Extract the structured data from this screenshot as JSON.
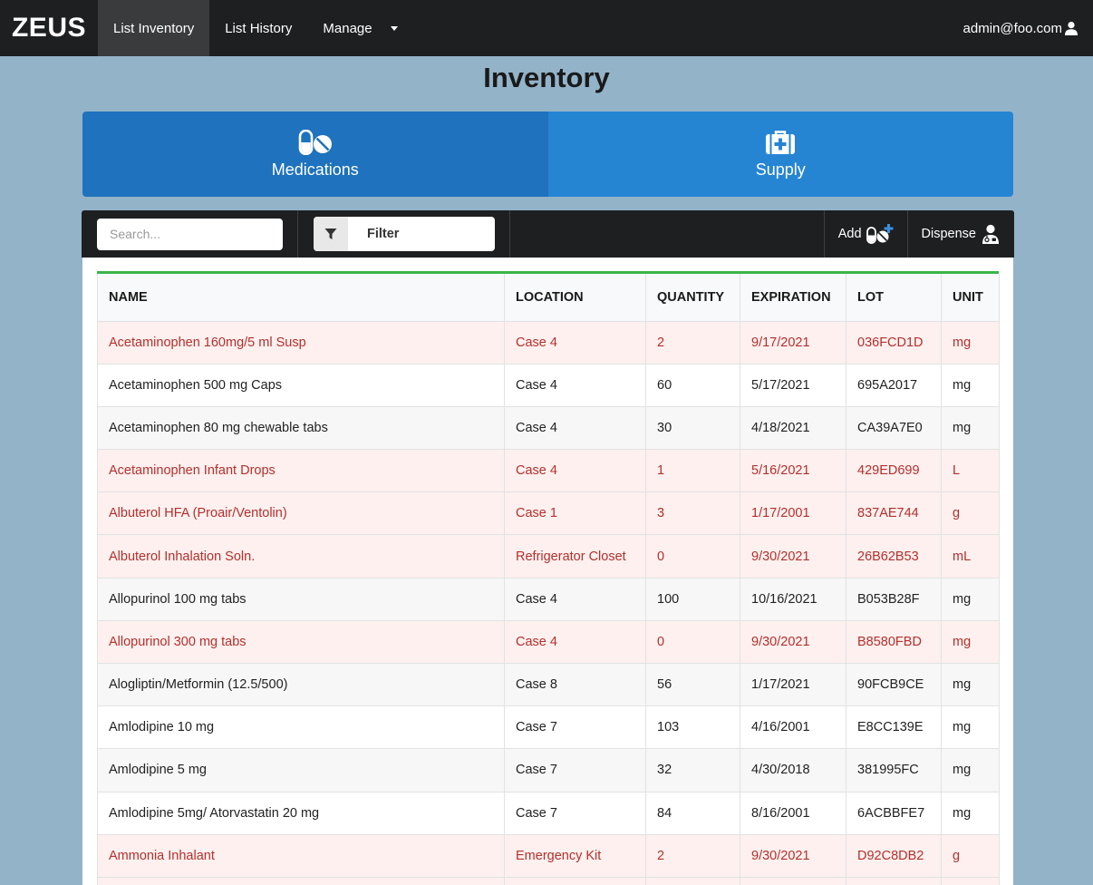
{
  "navbar": {
    "brand": "ZEUS",
    "items": [
      {
        "label": "List Inventory",
        "active": true
      },
      {
        "label": "List History",
        "active": false
      },
      {
        "label": "Manage",
        "active": false,
        "dropdown": true
      }
    ],
    "user_email": "admin@foo.com",
    "user_icon": "user-icon"
  },
  "page_title": "Inventory",
  "category_tabs": [
    {
      "label": "Medications",
      "icon": "pills-icon",
      "active": true
    },
    {
      "label": "Supply",
      "icon": "medkit-icon",
      "active": false
    }
  ],
  "toolbar": {
    "search_placeholder": "Search...",
    "search_value": "",
    "filter_label": "Filter",
    "add_label": "Add",
    "dispense_label": "Dispense"
  },
  "table": {
    "columns": [
      "NAME",
      "LOCATION",
      "QUANTITY",
      "EXPIRATION",
      "LOT",
      "UNIT"
    ],
    "rows": [
      {
        "name": "Acetaminophen 160mg/5 ml Susp",
        "location": "Case 4",
        "quantity": "2",
        "expiration": "9/17/2021",
        "lot": "036FCD1D",
        "unit": "mg",
        "alert": true
      },
      {
        "name": "Acetaminophen 500 mg Caps",
        "location": "Case 4",
        "quantity": "60",
        "expiration": "5/17/2021",
        "lot": "695A2017",
        "unit": "mg",
        "alert": false
      },
      {
        "name": "Acetaminophen 80 mg chewable tabs",
        "location": "Case 4",
        "quantity": "30",
        "expiration": "4/18/2021",
        "lot": "CA39A7E0",
        "unit": "mg",
        "alert": false
      },
      {
        "name": "Acetaminophen Infant Drops",
        "location": "Case 4",
        "quantity": "1",
        "expiration": "5/16/2021",
        "lot": "429ED699",
        "unit": "L",
        "alert": true
      },
      {
        "name": "Albuterol HFA (Proair/Ventolin)",
        "location": "Case 1",
        "quantity": "3",
        "expiration": "1/17/2001",
        "lot": "837AE744",
        "unit": "g",
        "alert": true
      },
      {
        "name": "Albuterol Inhalation Soln.",
        "location": "Refrigerator Closet",
        "quantity": "0",
        "expiration": "9/30/2021",
        "lot": "26B62B53",
        "unit": "mL",
        "alert": true
      },
      {
        "name": "Allopurinol 100 mg tabs",
        "location": "Case 4",
        "quantity": "100",
        "expiration": "10/16/2021",
        "lot": "B053B28F",
        "unit": "mg",
        "alert": false
      },
      {
        "name": "Allopurinol 300 mg tabs",
        "location": "Case 4",
        "quantity": "0",
        "expiration": "9/30/2021",
        "lot": "B8580FBD",
        "unit": "mg",
        "alert": true
      },
      {
        "name": "Alogliptin/Metformin (12.5/500)",
        "location": "Case 8",
        "quantity": "56",
        "expiration": "1/17/2021",
        "lot": "90FCB9CE",
        "unit": "mg",
        "alert": false
      },
      {
        "name": "Amlodipine 10 mg",
        "location": "Case 7",
        "quantity": "103",
        "expiration": "4/16/2001",
        "lot": "E8CC139E",
        "unit": "mg",
        "alert": false
      },
      {
        "name": "Amlodipine 5 mg",
        "location": "Case 7",
        "quantity": "32",
        "expiration": "4/30/2018",
        "lot": "381995FC",
        "unit": "mg",
        "alert": false
      },
      {
        "name": "Amlodipine 5mg/ Atorvastatin 20 mg",
        "location": "Case 7",
        "quantity": "84",
        "expiration": "8/16/2001",
        "lot": "6ACBBFE7",
        "unit": "mg",
        "alert": false
      },
      {
        "name": "Ammonia Inhalant",
        "location": "Emergency Kit",
        "quantity": "2",
        "expiration": "9/30/2021",
        "lot": "D92C8DB2",
        "unit": "g",
        "alert": true
      },
      {
        "name": "",
        "location": "",
        "quantity": "",
        "expiration": "",
        "lot": "",
        "unit": "",
        "alert": true
      }
    ]
  },
  "colors": {
    "page_bg": "#93b3c9",
    "navbar_bg": "#1e1f21",
    "tab_active": "#1f72bd",
    "tab_inactive": "#2685d3",
    "alert_text": "#b3302c",
    "alert_row_bg": "#fdf0ef",
    "table_top_border": "#3cb54a"
  }
}
